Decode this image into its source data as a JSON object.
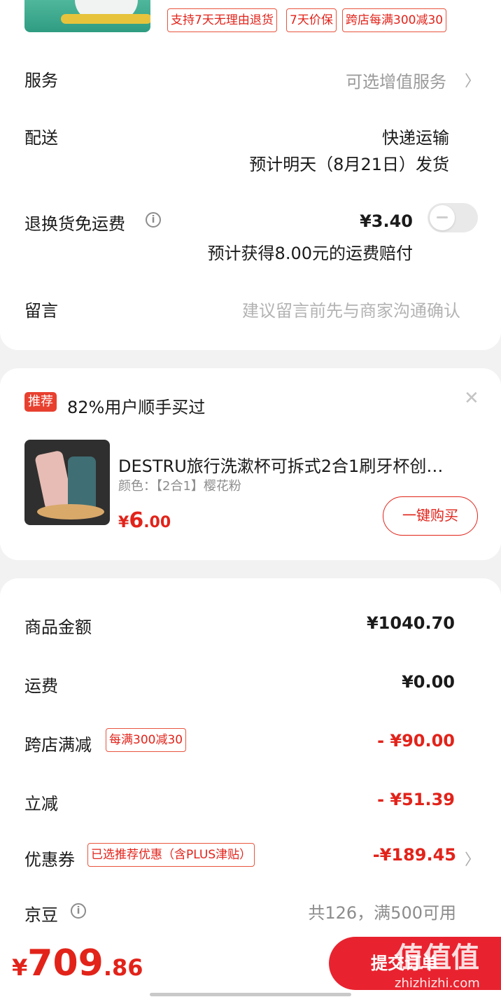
{
  "product_tags": [
    "支持7天无理由退货",
    "7天价保",
    "跨店每满300减30"
  ],
  "service": {
    "label": "服务",
    "value": "可选增值服务"
  },
  "delivery": {
    "label": "配送",
    "method": "快递运输",
    "eta": "预计明天（8月21日）发货"
  },
  "return_insurance": {
    "label": "退换货免运费",
    "price": "¥3.40",
    "note": "预计获得8.00元的运费赔付",
    "enabled": false
  },
  "message": {
    "label": "留言",
    "placeholder": "建议留言前先与商家沟通确认"
  },
  "recommend": {
    "badge": "推荐",
    "title": "82%用户顺手买过",
    "product_name": "DESTRU旅行洗漱杯可拆式2合1刷牙杯创…",
    "spec": "颜色：【2合1】樱花粉",
    "price_currency": "¥",
    "price_int": "6",
    "price_dec": ".00",
    "buy_label": "一键购买"
  },
  "summary": {
    "goods_amount": {
      "label": "商品金额",
      "value": "¥1040.70"
    },
    "shipping": {
      "label": "运费",
      "value": "¥0.00"
    },
    "cross_store": {
      "label": "跨店满减",
      "tag": "每满300减30",
      "value": "- ¥90.00"
    },
    "instant": {
      "label": "立减",
      "value": "- ¥51.39"
    },
    "coupon": {
      "label": "优惠券",
      "tag": "已选推荐优惠（含PLUS津贴）",
      "value": "-¥189.45"
    },
    "jingdou": {
      "label": "京豆",
      "value": "共126，满500可用"
    }
  },
  "footer": {
    "total_currency": "¥",
    "total_int": "709",
    "total_dec": ".86",
    "submit_label": "提交订单",
    "watermark": "值值值",
    "watermark_url": "zhizhizhi.com"
  },
  "colors": {
    "accent": "#e2231a",
    "background": "#f2f2f2"
  }
}
